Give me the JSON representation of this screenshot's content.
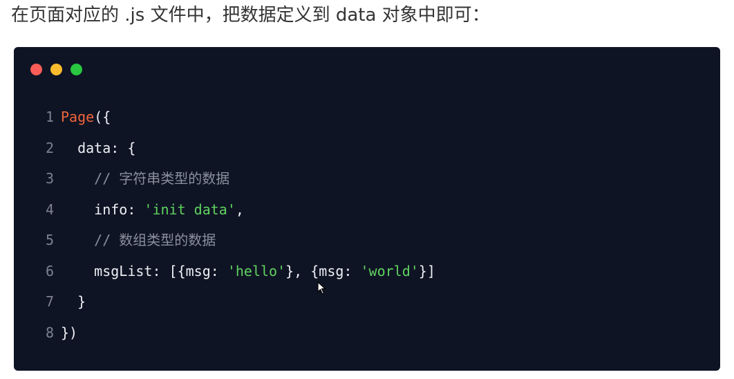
{
  "intro_text": "在页面对应的 .js 文件中，把数据定义到 data 对象中即可：",
  "window_controls": [
    "close-dot",
    "minimize-dot",
    "maximize-dot"
  ],
  "code": {
    "lines": [
      {
        "num": "1",
        "indent": "",
        "tokens": [
          {
            "t": "Page",
            "k": "fn"
          },
          {
            "t": "({",
            "k": "plain"
          }
        ]
      },
      {
        "num": "2",
        "indent": "  ",
        "tokens": [
          {
            "t": "data: {",
            "k": "plain"
          }
        ]
      },
      {
        "num": "3",
        "indent": "    ",
        "tokens": [
          {
            "t": "// 字符串类型的数据",
            "k": "comment"
          }
        ]
      },
      {
        "num": "4",
        "indent": "    ",
        "tokens": [
          {
            "t": "info: ",
            "k": "plain"
          },
          {
            "t": "'init data'",
            "k": "str"
          },
          {
            "t": ",",
            "k": "plain"
          }
        ]
      },
      {
        "num": "5",
        "indent": "    ",
        "tokens": [
          {
            "t": "// 数组类型的数据",
            "k": "comment"
          }
        ]
      },
      {
        "num": "6",
        "indent": "    ",
        "tokens": [
          {
            "t": "msgList: [{msg: ",
            "k": "plain"
          },
          {
            "t": "'hello'",
            "k": "str"
          },
          {
            "t": "}, {msg: ",
            "k": "plain"
          },
          {
            "t": "'world'",
            "k": "str"
          },
          {
            "t": "}]",
            "k": "plain"
          }
        ]
      },
      {
        "num": "7",
        "indent": "  ",
        "tokens": [
          {
            "t": "}",
            "k": "plain"
          }
        ]
      },
      {
        "num": "8",
        "indent": "",
        "tokens": [
          {
            "t": "})",
            "k": "plain"
          }
        ]
      }
    ]
  },
  "colors": {
    "background": "#0f1424",
    "function": "#f0653d",
    "string": "#5fd35f",
    "comment": "#8a8f9c",
    "text": "#eef0f5",
    "line_number": "#7d8290"
  }
}
